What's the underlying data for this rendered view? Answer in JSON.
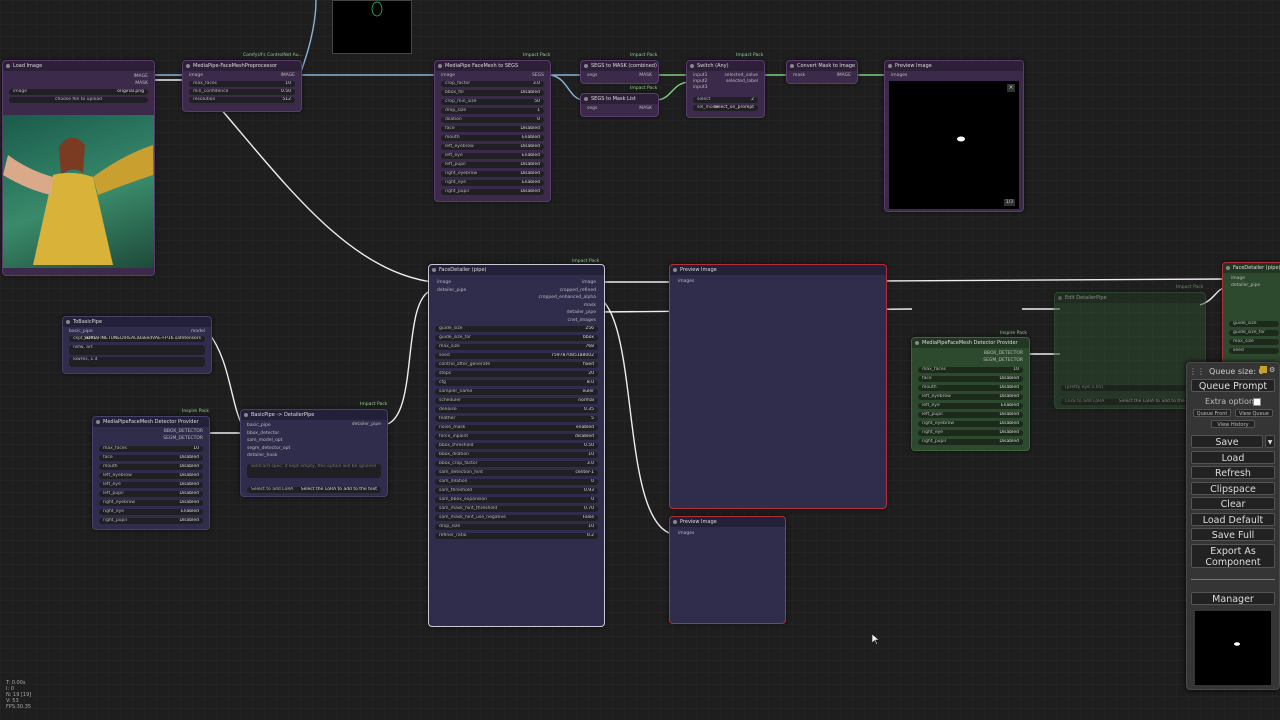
{
  "nodes": {
    "load_image": {
      "title": "Load Image",
      "out1": "IMAGE",
      "out2": "MASK",
      "image_label": "image",
      "image_value": "original.png",
      "upload_label": "choose file to upload"
    },
    "preproc": {
      "title": "MediaPipe-FaceMeshPreprocessor",
      "pack": "ComfyUI's ControlNet Au...",
      "in": "image",
      "out": "IMAGE",
      "w1": "max_faces",
      "v1": "10",
      "w2": "min_confidence",
      "v2": "0.50",
      "w3": "resolution",
      "v3": "512"
    },
    "facemesh_segs": {
      "title": "MediaPipe FaceMesh to SEGS",
      "pack": "Impact Pack",
      "in": "image",
      "out": "SEGS",
      "rows": [
        [
          "crop_factor",
          "3.0"
        ],
        [
          "bbox_fill",
          "Disabled"
        ],
        [
          "crop_min_size",
          "50"
        ],
        [
          "drop_size",
          "1"
        ],
        [
          "dilation",
          "0"
        ],
        [
          "face",
          "Disabled"
        ],
        [
          "mouth",
          "Enabled"
        ],
        [
          "left_eyebrow",
          "Disabled"
        ],
        [
          "left_eye",
          "Enabled"
        ],
        [
          "left_pupil",
          "Disabled"
        ],
        [
          "right_eyebrow",
          "Disabled"
        ],
        [
          "right_eye",
          "Enabled"
        ],
        [
          "right_pupil",
          "Disabled"
        ]
      ]
    },
    "segs_to_mask": {
      "title": "SEGS to MASK (combined)",
      "pack": "Impact Pack",
      "in": "segs",
      "out": "MASK"
    },
    "segs_to_mask_list": {
      "title": "SEGS to Mask List",
      "pack": "Impact Pack",
      "in": "segs",
      "out": "MASK"
    },
    "switch": {
      "title": "Switch (Any)",
      "pack": "Impact Pack",
      "in1": "input1",
      "in2": "input2",
      "in3": "input3",
      "out1": "selected_value",
      "out2": "selected_label",
      "w1": "select",
      "v1": "2",
      "w2": "sel_mode",
      "v2": "select_on_prompt"
    },
    "convert_mask": {
      "title": "Convert Mask to Image",
      "in": "mask",
      "out": "IMAGE"
    },
    "preview_top": {
      "title": "Preview Image",
      "in": "images",
      "counter": "1/3"
    },
    "to_basic_pipe": {
      "title": "ToBasicPipe",
      "in": "basic_pipe",
      "out": "model",
      "prompt_a": "masterpiece",
      "ckpt_label": "ckpt_name",
      "ckpt_value": "SDXL\\FINETUNED\\REAL\\BakedVAE-FP16.safetensors",
      "text1": "nsfw, art",
      "text2": "lowres, 1.4"
    },
    "facedetailer": {
      "title": "FaceDetailer (pipe)",
      "pack": "Impact Pack",
      "in1": "image",
      "in2": "detailer_pipe",
      "outs": [
        "image",
        "cropped_refined",
        "cropped_enhanced_alpha",
        "mask",
        "detailer_pipe",
        "cnet_images"
      ],
      "rows": [
        [
          "guide_size",
          "256"
        ],
        [
          "guide_size_for",
          "bbox"
        ],
        [
          "max_size",
          "768"
        ],
        [
          "seed",
          "759787085188002"
        ],
        [
          "control_after_generate",
          "fixed"
        ],
        [
          "steps",
          "20"
        ],
        [
          "cfg",
          "8.0"
        ],
        [
          "sampler_name",
          "euler"
        ],
        [
          "scheduler",
          "normal"
        ],
        [
          "denoise",
          "0.35"
        ],
        [
          "feather",
          "5"
        ],
        [
          "noise_mask",
          "enabled"
        ],
        [
          "force_inpaint",
          "disabled"
        ],
        [
          "bbox_threshold",
          "0.50"
        ],
        [
          "bbox_dilation",
          "10"
        ],
        [
          "bbox_crop_factor",
          "3.0"
        ],
        [
          "sam_detection_hint",
          "center-1"
        ],
        [
          "sam_dilation",
          "0"
        ],
        [
          "sam_threshold",
          "0.93"
        ],
        [
          "sam_bbox_expansion",
          "0"
        ],
        [
          "sam_mask_hint_threshold",
          "0.70"
        ],
        [
          "sam_mask_hint_use_negative",
          "False"
        ],
        [
          "drop_size",
          "10"
        ],
        [
          "refiner_ratio",
          "0.2"
        ]
      ]
    },
    "preview_mid": {
      "title": "Preview Image",
      "in": "images"
    },
    "preview_small": {
      "title": "Preview Image",
      "in": "images"
    },
    "detector_left": {
      "title": "MediaPipeFaceMesh Detector Provider",
      "pack": "Inspire Pack",
      "out1": "BBOX_DETECTOR",
      "out2": "SEGM_DETECTOR",
      "rows": [
        [
          "max_faces",
          "10"
        ],
        [
          "face",
          "Disabled"
        ],
        [
          "mouth",
          "Disabled"
        ],
        [
          "left_eyebrow",
          "Disabled"
        ],
        [
          "left_eye",
          "Disabled"
        ],
        [
          "left_pupil",
          "Disabled"
        ],
        [
          "right_eyebrow",
          "Disabled"
        ],
        [
          "right_eye",
          "Enabled"
        ],
        [
          "right_pupil",
          "Disabled"
        ]
      ]
    },
    "basicpipe_detailer": {
      "title": "BasicPipe -> DetailerPipe",
      "pack": "Impact Pack",
      "ins": [
        "basic_pipe",
        "bbox_detector",
        "sam_model_opt",
        "segm_detector_opt",
        "detailer_hook"
      ],
      "out": "detailer_pipe",
      "wildcard": "wildcard spec: if kept empty, this option will be ignored",
      "lora_left": "Select to add LoRA",
      "lora_right": "Select the LoRA to add to the text"
    },
    "detector_right": {
      "title": "MediaPipeFaceMesh Detector Provider",
      "pack": "Inspire Pack",
      "out1": "BBOX_DETECTOR",
      "out2": "SEGM_DETECTOR",
      "rows": [
        [
          "max_faces",
          "10"
        ],
        [
          "face",
          "Disabled"
        ],
        [
          "mouth",
          "Disabled"
        ],
        [
          "left_eyebrow",
          "Disabled"
        ],
        [
          "left_eye",
          "Enabled"
        ],
        [
          "left_pupil",
          "Disabled"
        ],
        [
          "right_eyebrow",
          "Disabled"
        ],
        [
          "right_eye",
          "Disabled"
        ],
        [
          "right_pupil",
          "Disabled"
        ]
      ]
    },
    "edit_detailer": {
      "title": "Edit DetailerPipe",
      "pack": "Impact Pack",
      "prompt": "(pretty eye:1.05)",
      "lora_left": "Click to add LoRA",
      "lora_right": "Select the LoRA to add to the text"
    },
    "facedetailer_right": {
      "title": "FaceDetailer (pipe)",
      "in1": "image",
      "in2": "detailer_pipe",
      "rows": [
        [
          "guide_size",
          ""
        ],
        [
          "guide_size_for",
          ""
        ],
        [
          "max_size",
          ""
        ],
        [
          "seed",
          ""
        ]
      ]
    }
  },
  "menu": {
    "queue_size": "Queue size: 0",
    "queue_prompt": "Queue Prompt",
    "extra_options": "Extra options",
    "queue_front": "Queue Front",
    "view_queue": "View Queue",
    "view_history": "View History",
    "save": "Save",
    "load": "Load",
    "refresh": "Refresh",
    "clipspace": "Clipspace",
    "clear": "Clear",
    "load_default": "Load Default",
    "save_full": "Save Full",
    "export_component": "Export As Component",
    "manager": "Manager"
  },
  "stats": {
    "t": "T: 0.00s",
    "i": "I: 0",
    "n": "N: 19 [19]",
    "v": "V: 53",
    "fps": "FPS:30.35"
  },
  "colors": {
    "wire_white": "#e8e8e8",
    "wire_blue": "#8ab4d8",
    "wire_green": "#7fd07f",
    "node_purple": "#3b2a4a",
    "node_blue": "#2f2c4c",
    "node_green": "#2e4a2e",
    "sel_red": "#b3303a"
  }
}
